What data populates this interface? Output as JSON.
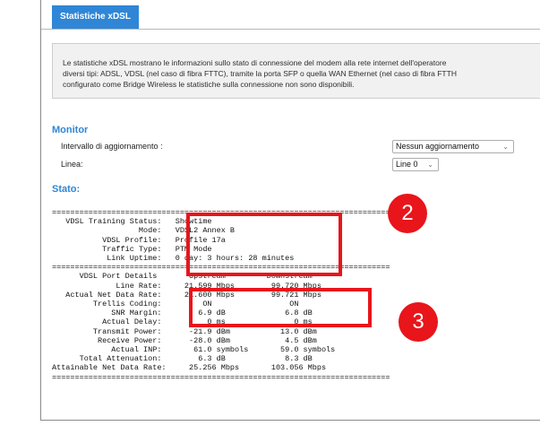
{
  "tab": {
    "label": "Statistiche xDSL"
  },
  "info": {
    "lines": [
      "Le statistiche xDSL mostrano le informazioni sullo stato di connessione del modem alla rete internet dell'operatore",
      "diversi tipi: ADSL, VDSL (nel caso di fibra FTTC), tramite la porta SFP o quella WAN Ethernet (nel caso di fibra FTTH",
      "configurato come Bridge Wireless le statistiche sulla connessione non sono disponibili."
    ]
  },
  "monitor": {
    "title": "Monitor",
    "interval_label": "Intervallo di aggiornamento :",
    "interval_value": "Nessun aggiornamento",
    "line_label": "Linea:",
    "line_value": "Line 0"
  },
  "status": {
    "title": "Stato:",
    "console_lines": [
      "==========================================================================",
      "   VDSL Training Status:   Showtime",
      "                   Mode:   VDSL2 Annex B",
      "           VDSL Profile:   Profile 17a",
      "           Traffic Type:   PTM Mode",
      "            Link Uptime:   0 day: 3 hours: 28 minutes",
      "==========================================================================",
      "      VDSL Port Details       Upstream         Downstream",
      "              Line Rate:     21.599 Mbps        99.720 Mbps",
      "   Actual Net Data Rate:     21.600 Mbps        99.721 Mbps",
      "         Trellis Coding:         ON                 ON",
      "             SNR Margin:        6.9 dB             6.8 dB",
      "           Actual Delay:          0 ms               0 ms",
      "         Transmit Power:      -21.9 dBm           13.0 dBm",
      "          Receive Power:      -28.0 dBm            4.5 dBm",
      "             Actual INP:       61.0 symbols       59.0 symbols",
      "      Total Attenuation:        6.3 dB             8.3 dB",
      "Attainable Net Data Rate:     25.256 Mbps       103.056 Mbps",
      "=========================================================================="
    ]
  },
  "callouts": {
    "a": "2",
    "b": "3"
  },
  "colors": {
    "accent": "#2f86d6",
    "callout": "#e8151b"
  }
}
